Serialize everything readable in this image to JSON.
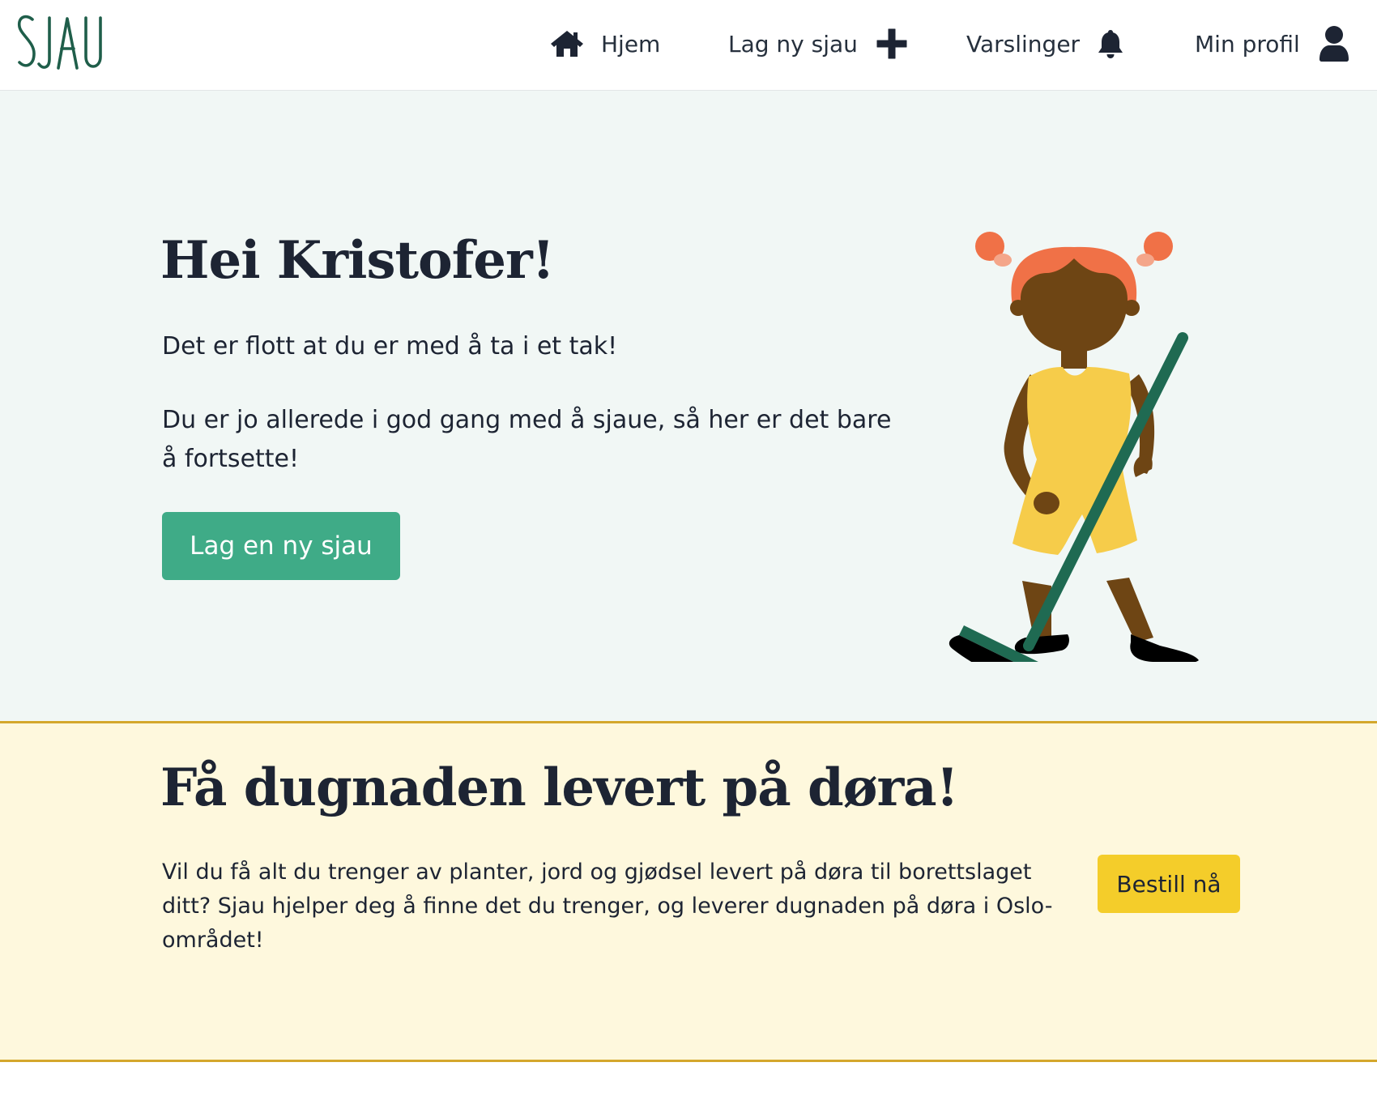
{
  "header": {
    "logo_text": "SJAU",
    "nav": [
      {
        "label": "Hjem",
        "icon": "home-icon"
      },
      {
        "label": "Lag ny sjau",
        "icon": "plus-icon"
      },
      {
        "label": "Varslinger",
        "icon": "bell-icon"
      },
      {
        "label": "Min profil",
        "icon": "user-icon"
      }
    ]
  },
  "hero": {
    "title": "Hei Kristofer!",
    "line1": "Det er flott at du er med å ta i et tak!",
    "line2": "Du er jo allerede i god gang med å sjaue, så her er det bare å fortsette!",
    "button_label": "Lag en ny sjau",
    "illustration": "person-sweeping-illustration"
  },
  "delivery": {
    "title": "Få dugnaden levert på døra!",
    "text": "Vil du få alt du trenger av planter, jord og gjødsel levert på døra til borettslaget ditt? Sjau hjelper deg å finne det du trenger, og leverer dugnaden på døra i Oslo-området!",
    "button_label": "Bestill nå"
  },
  "colors": {
    "brand_green": "#1f5e4a",
    "button_green": "#3fab87",
    "hero_bg": "#f1f7f5",
    "delivery_bg": "#fef8dd",
    "accent_yellow": "#f4cd2a",
    "border_gold": "#d4a72c",
    "text_dark": "#1d2433"
  }
}
